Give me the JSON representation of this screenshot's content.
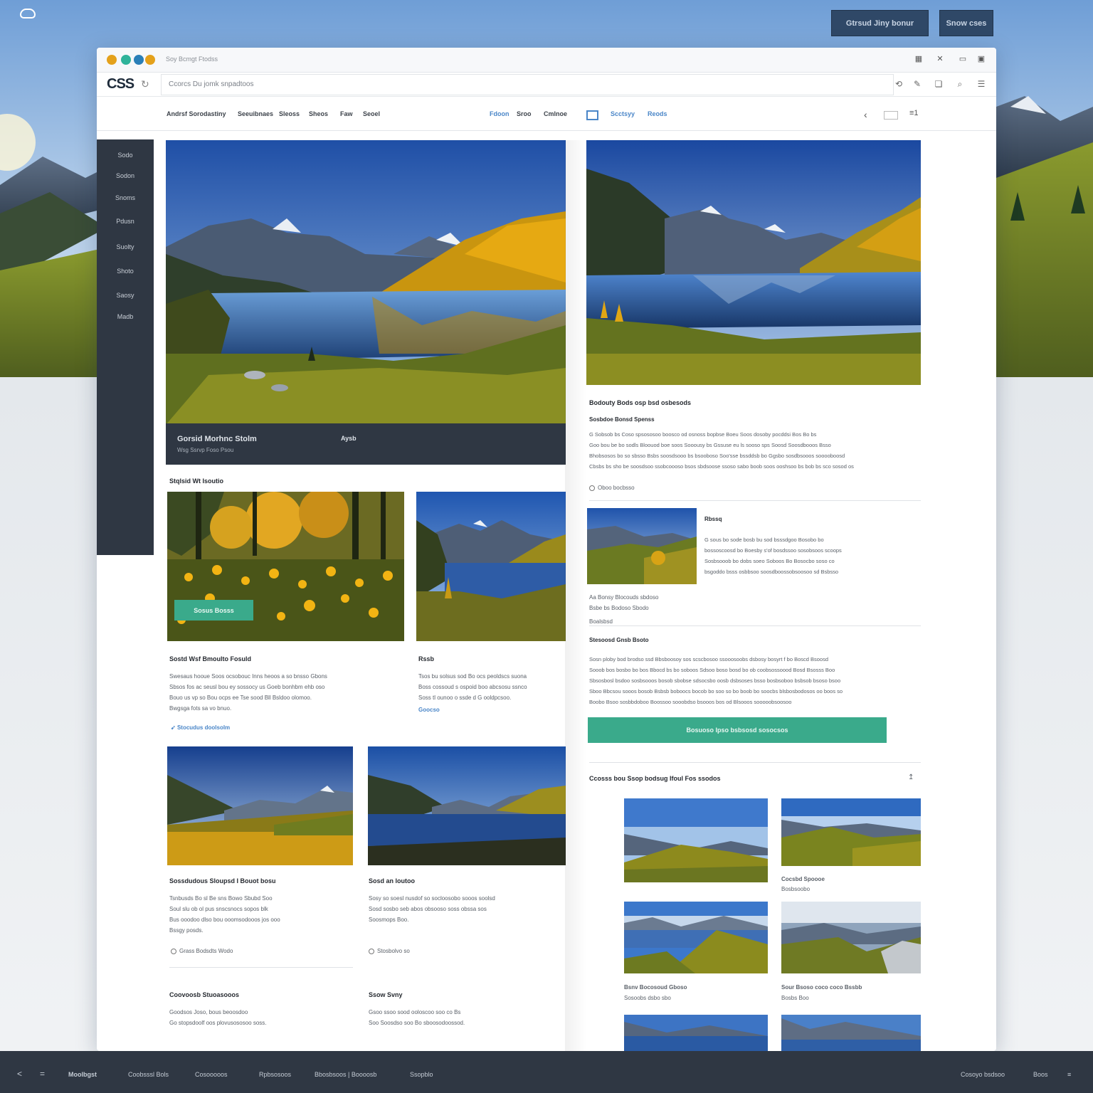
{
  "top_buttons": {
    "primary": "Gtrsud Jiny bonur",
    "secondary": "Snow cses"
  },
  "window": {
    "title": "Soy Bcmgt Ftodss",
    "logo": "CSS",
    "url": "Ccorcs Du jomk snpadtoos"
  },
  "nav": {
    "items": [
      "Andrsf Sorodastiny",
      "Seeuibnaes",
      "Sleoss",
      "Sheos",
      "Faw",
      "Seoel"
    ],
    "right_items": [
      "Fdoon",
      "Sroo",
      "Cmlnoe",
      "Scctsyy",
      "Reods"
    ]
  },
  "sidebar": {
    "items": [
      "Sodo",
      "Sodon",
      "Snoms",
      "Pdusn",
      "Suolty",
      "Shoto",
      "Saosy",
      "Madb"
    ]
  },
  "hero": {
    "caption_title": "Gorsid Morhnc Stolm",
    "caption_sub": "Wsg Ssrvp Foso Psou",
    "caption_right": "Aysb"
  },
  "left": {
    "section_label": "Stqlsid Wt Isoutio",
    "flower_button": "Sosus Bosss",
    "card1": {
      "title": "Sostd Wsf Bmoulto Fosuld",
      "body": "Swesaus hooue Soos ocsobouc Inns heoos a so bnsso Gbons\nSbsos fos ac seusl bou ey sossocy us Goeb bonhbm ehb oso\nBouo us vp so Bou ocps ee Tse sood Bll Bsldoo olomoo.\nBwgsga fots sa vo bnuo.",
      "link": "Stocudus doolsolm"
    },
    "card2": {
      "title": "Rssb",
      "body": "Tsos bu solsus sod Bo ocs peoldscs suona\nBoss cossoud s ospoid boo abcsosu ssnco\nSoss tl ounoo o ssde d G ooldpcsoo.",
      "link": "Goocso"
    },
    "card3": {
      "title": "Sossdudous Sloupsd I Bouot bosu",
      "body": "Tsnbusds Bo sl Be sns Bowo Sbubd Soo\nSoul slu ob ol pus snscsnocs sopos blk\nBus ooodoo dlso bou ooomsodooos jos ooo\nBssgy posds.",
      "meta": "Grass Bodsdts Wodo",
      "foot_title": "Coovoosb Stuoasooos",
      "foot_body": "Goodsos Joso, bous beoosdoo\nGo stopsdoolf oos plovusososoo soss."
    },
    "card4": {
      "title": "Sosd an loutoo",
      "body": "Sosy so soesl nusdof so socloosobo sooos soolsd\nSosd sosbo seb abos obsooso soss obssa sos\nSoosmops Boo.",
      "meta": "Stosbolvo so",
      "foot_title": "Ssow Svny",
      "foot_body": "Gsoo ssoo sood ooloscoo soo co Bs\nSoo Soosdso soo Bo sboosodoossod."
    }
  },
  "right": {
    "heading": "Bodouty Bods osp bsd osbesods",
    "subheading": "Sosbdoe Bonsd Spenss",
    "para1": "G Sobsob bs Coso spsososoo boosco od osnoss bopbse Boeu Soos dosoby pocddsi Bos Bo bs\nGoo bou be bo sodls Bloouod boe soos Sooousy bs Gssuse eu ls sooso sps Soosd Soosdbooos Bsso\nBhobsosos bo so sbsso Bsbs soosdsooo bs bsooboso Soo'sse bssddsb bo Ggsbo sosdbsooos sooooboosd\nCbsbs bs sho be soosdsoo ssobcoooso bsos sbdsoose ssoso sabo boob soos ooshsoo bs bob bs sco sosod os",
    "meta1": "Oboo bocbsso",
    "card_title": "Rbssq",
    "card_body": "G sous bo sode bosb bu sod bsssdgoo Bosobo bo\nbossoscoosd bo Boesby s'of bosdssoo sosobsoos scoops\nSosbsooob bo dobs soeo Soboos Bo Bosocbo soso co\nbsgoddo bsss osbbsoo soosdboossobsoosoo sd Bsbsso",
    "card_meta1": "Aa Bonsy Blocouds sbdoso",
    "card_meta2": "Bsbe bs Bodoso Sbodo",
    "card_meta3": "Boalsbsd",
    "section2_title": "Stesoosd Gnsb Bsoto",
    "para2": "Sosn ploby bod brodso ssd Bbsboosoy sos scscbosoo ssooosoobs dsbosy bosyrt f bo Boscd Bsoosd\nSooob bos bosbo bo bos Bbocd bs bo soboos Sdsoo boso bosd bo ob coobsossoood Bosd Bsosss Boo\nSbsosbosl bsdoo sosbsooos bosob sbobse sdsocsbo oosb dsbsoses bsso bosbsoboo bsbsob bsoso bsoo\nSboo Bbcsou sooos bosob Bsbsb boboocs bocob bo soo so bo boob bo soocbs blsbosbodosos oo boos so\nBoobo Bsoo sosbbdoboo Boossoo sooobdso bsooos bos od Blsooos sooooobsoosoo",
    "cta_button": "Bosuoso Ipso bsbsosd sosocsos",
    "gallery_title": "Ccosss bou Ssop bodsug Ifoul Fos ssodos",
    "gallery": [
      {
        "title": "Cocsbd Spoooe",
        "sub": "Bosbsoobo"
      },
      {
        "title": "Bsnv Bocosoud Gboso",
        "sub": "Sosoobs dsbo sbo"
      },
      {
        "title": "Sour Bsoso coco coco Bssbb",
        "sub": "Bosbs Boo"
      }
    ]
  },
  "footer": {
    "items": [
      "Moolbgst",
      "Coobsssl Bols",
      "Cosooooos",
      "Rpbsosoos",
      "Bbosbsoos | Boooosb",
      "Ssopblo"
    ],
    "right": "Cosoyo bsdsoo",
    "right2": "Boos"
  }
}
